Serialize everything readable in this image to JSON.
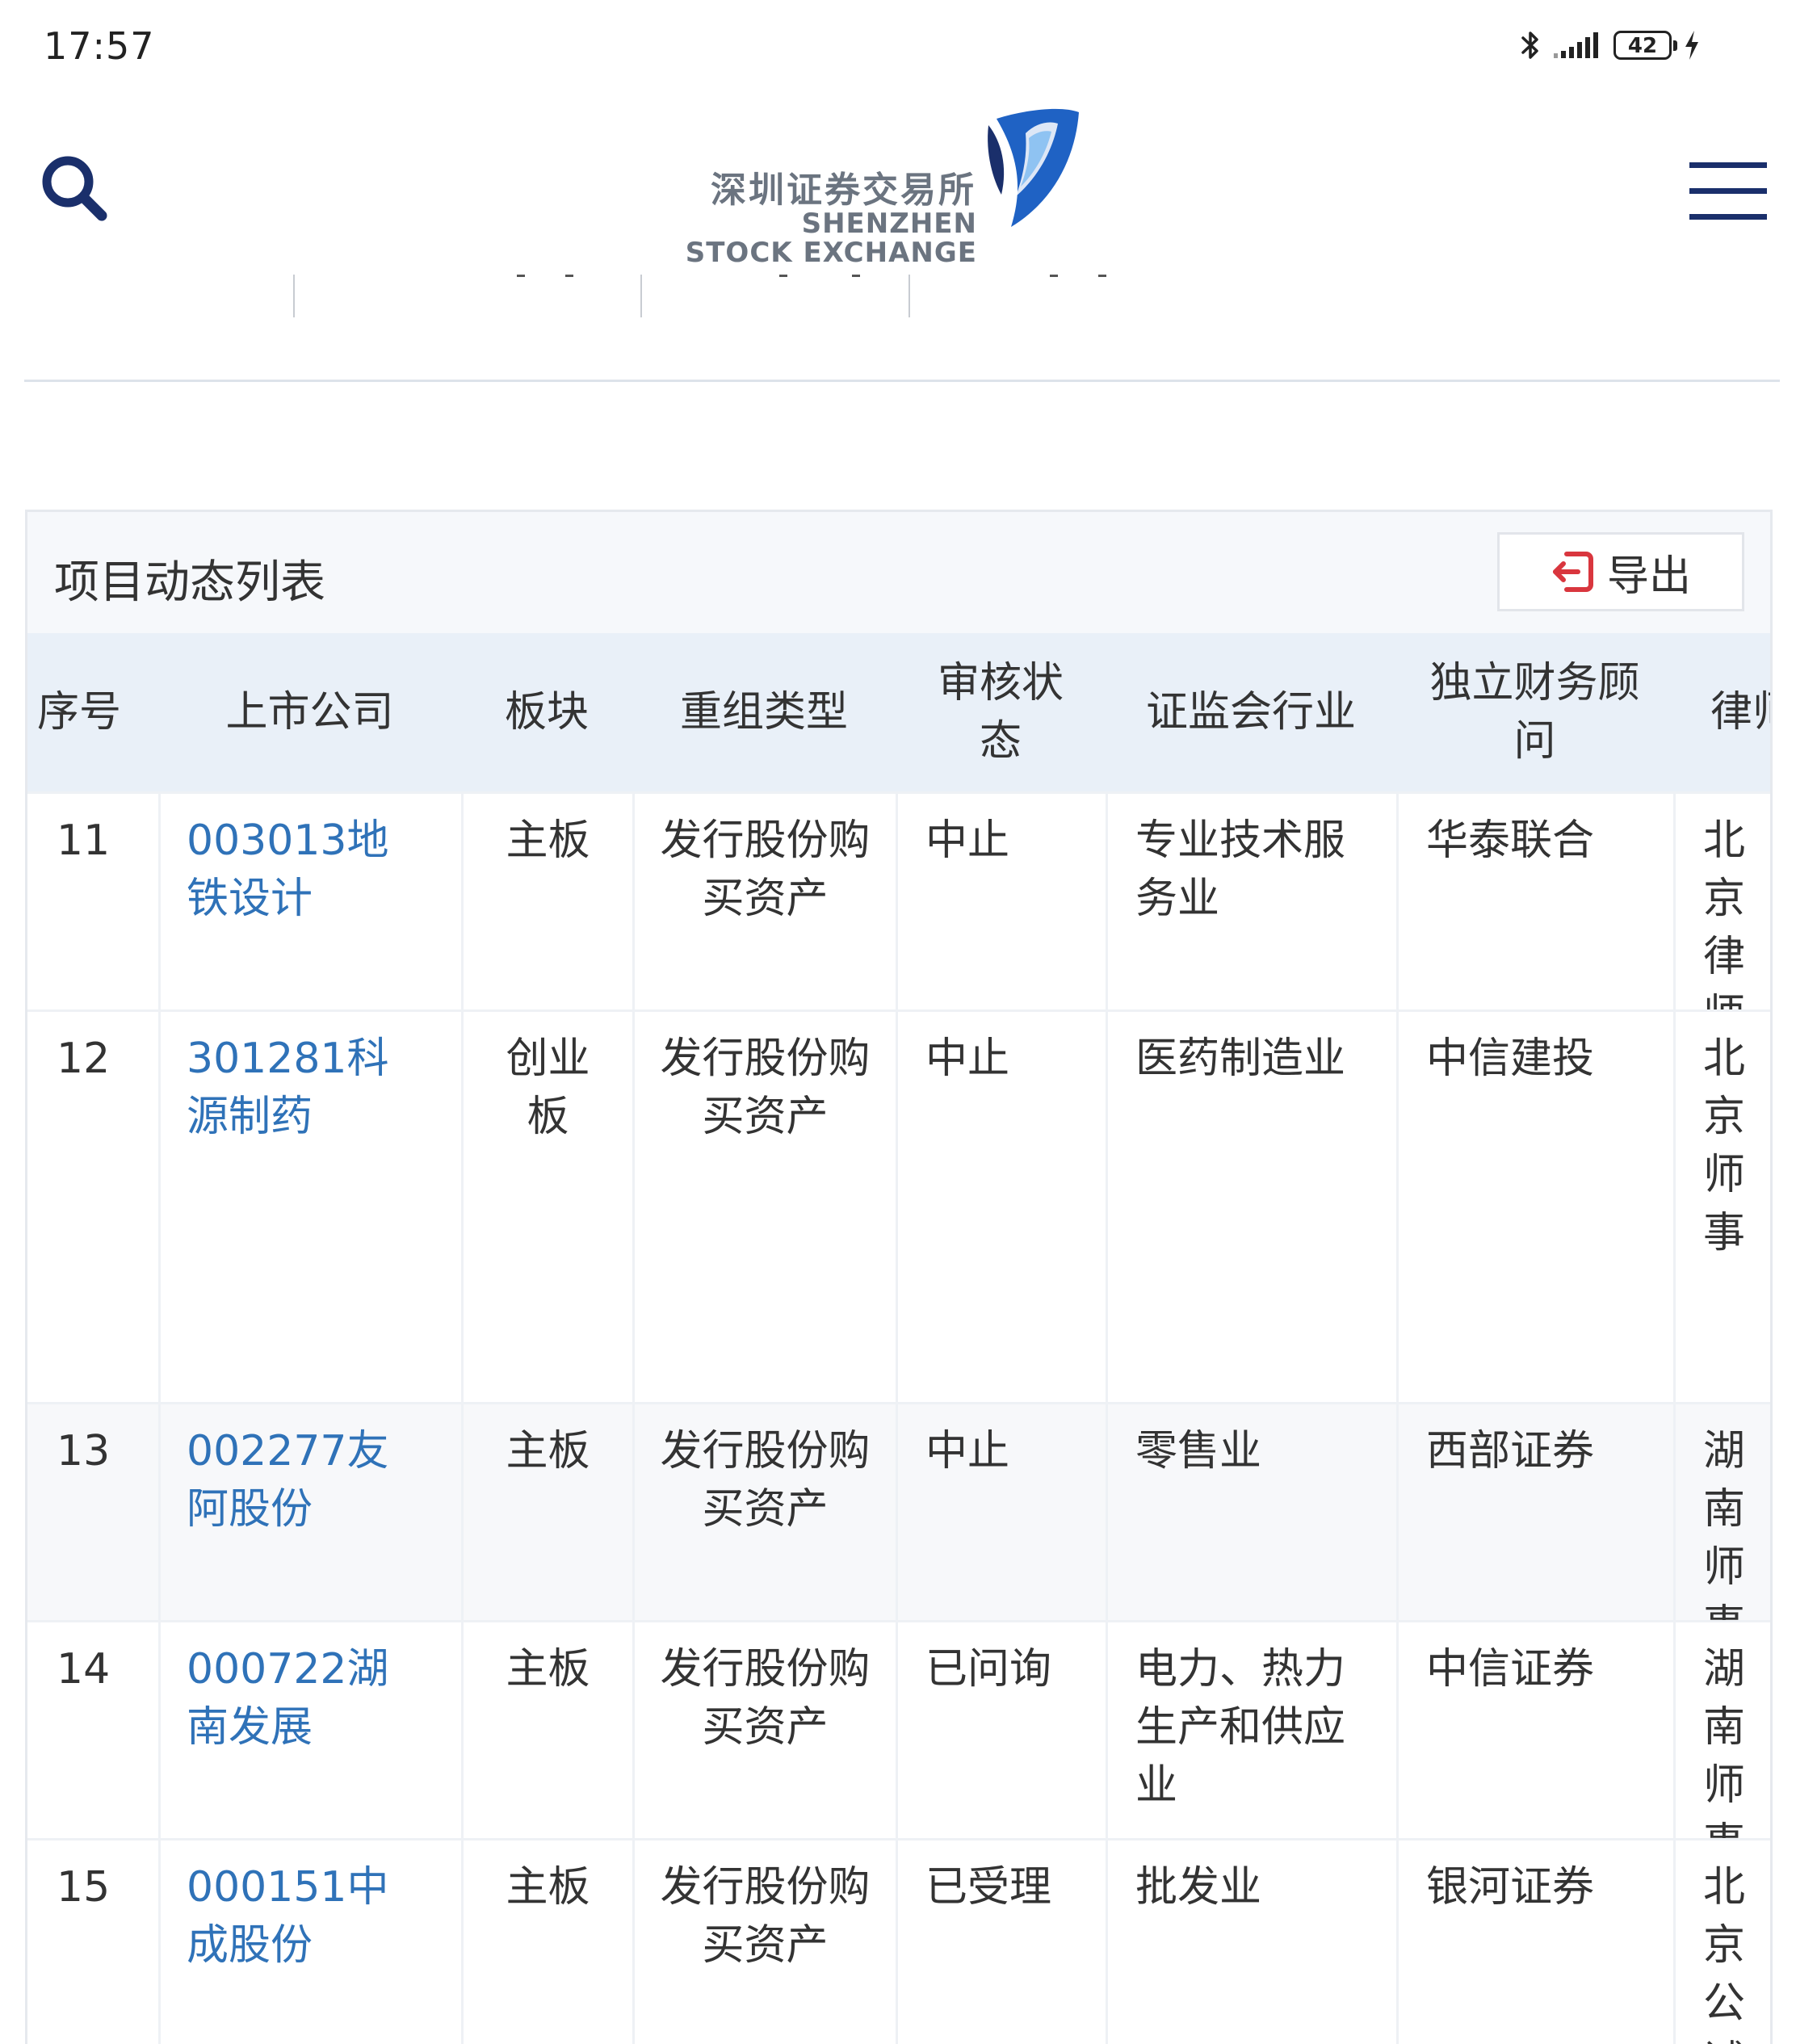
{
  "status_bar": {
    "time": "17:57",
    "battery": "42",
    "icons": [
      "bluetooth-icon",
      "signal-icon",
      "battery-icon",
      "charging-bolt-icon"
    ]
  },
  "header": {
    "logo_cn": "深圳证券交易所",
    "logo_en_line1": "SHENZHEN",
    "logo_en_line2": "STOCK EXCHANGE",
    "icons": [
      "search-icon",
      "menu-icon"
    ],
    "colors": {
      "navy": "#1a2f6b",
      "logo_blue": "#1f62c4",
      "logo_gray": "#6b7480"
    }
  },
  "panel": {
    "title": "项目动态列表",
    "export_label": "导出",
    "export_icon": "export-icon",
    "export_icon_color": "#d9363e"
  },
  "table": {
    "headers": [
      "序号",
      "上市公司",
      "板块",
      "重组类型",
      "审核状态",
      "证监会行业",
      "独立财务顾问",
      "律师"
    ],
    "link_color": "#2f72b8",
    "rows": [
      {
        "no": "11",
        "company": "003013地铁设计",
        "board": "主板",
        "type": "发行股份购买资产",
        "status": "中止",
        "industry": "专业技术服务业",
        "advisor": "华泰联合",
        "lawyer": "北京律师"
      },
      {
        "no": "12",
        "company": "301281科源制药",
        "board": "创业板",
        "type": "发行股份购买资产",
        "status": "中止",
        "industry": "医药制造业",
        "advisor": "中信建投",
        "lawyer": "北京师事"
      },
      {
        "no": "13",
        "company": "002277友阿股份",
        "board": "主板",
        "type": "发行股份购买资产",
        "status": "中止",
        "industry": "零售业",
        "advisor": "西部证券",
        "lawyer": "湖南师事"
      },
      {
        "no": "14",
        "company": "000722湖南发展",
        "board": "主板",
        "type": "发行股份购买资产",
        "status": "已问询",
        "industry": "电力、热力生产和供应业",
        "advisor": "中信证券",
        "lawyer": "湖南师事"
      },
      {
        "no": "15",
        "company": "000151中成股份",
        "board": "主板",
        "type": "发行股份购买资产",
        "status": "已受理",
        "industry": "批发业",
        "advisor": "银河证券",
        "lawyer": "北京公诚务所"
      }
    ]
  }
}
